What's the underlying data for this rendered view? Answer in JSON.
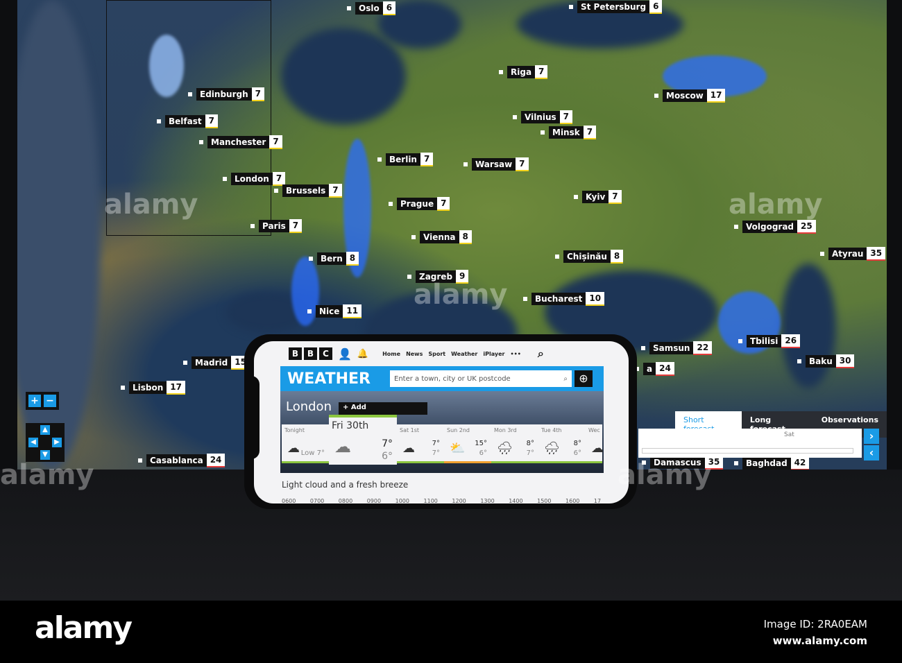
{
  "map": {
    "cities": [
      {
        "name": "Oslo",
        "temp": "6"
      },
      {
        "name": "St Petersburg",
        "temp": "6"
      },
      {
        "name": "Edinburgh",
        "temp": "7"
      },
      {
        "name": "Riga",
        "temp": "7"
      },
      {
        "name": "Moscow",
        "temp": "17"
      },
      {
        "name": "Belfast",
        "temp": "7"
      },
      {
        "name": "Vilnius",
        "temp": "7"
      },
      {
        "name": "Minsk",
        "temp": "7"
      },
      {
        "name": "Manchester",
        "temp": "7"
      },
      {
        "name": "Berlin",
        "temp": "7"
      },
      {
        "name": "Warsaw",
        "temp": "7"
      },
      {
        "name": "London",
        "temp": "7"
      },
      {
        "name": "Brussels",
        "temp": "7"
      },
      {
        "name": "Prague",
        "temp": "7"
      },
      {
        "name": "Kyiv",
        "temp": "7"
      },
      {
        "name": "Volgograd",
        "temp": "25"
      },
      {
        "name": "Paris",
        "temp": "7"
      },
      {
        "name": "Vienna",
        "temp": "8"
      },
      {
        "name": "Atyrau",
        "temp": "35"
      },
      {
        "name": "Chișinău",
        "temp": "8"
      },
      {
        "name": "Bern",
        "temp": "8"
      },
      {
        "name": "Zagreb",
        "temp": "9"
      },
      {
        "name": "Bucharest",
        "temp": "10"
      },
      {
        "name": "Nice",
        "temp": "11"
      },
      {
        "name": "Tbilisi",
        "temp": "26"
      },
      {
        "name": "Samsun",
        "temp": "22"
      },
      {
        "name": "Baku",
        "temp": "30"
      },
      {
        "name": "Madrid",
        "temp": "15"
      },
      {
        "name": "Lisbon",
        "temp": "17"
      },
      {
        "name": "Casablanca",
        "temp": "24"
      },
      {
        "name": "Damascus",
        "temp": "35"
      },
      {
        "name": "Baghdad",
        "temp": "42"
      },
      {
        "name": "a",
        "temp": "24"
      }
    ],
    "zoom_in": "+",
    "zoom_out": "−",
    "tabs": [
      "Short forecast",
      "Long forecast",
      "Observations"
    ],
    "timeline_label": "Sat",
    "next": "›",
    "prev": "‹"
  },
  "phone": {
    "bbc": [
      "B",
      "B",
      "C"
    ],
    "nav": [
      "Home",
      "News",
      "Sport",
      "Weather",
      "iPlayer",
      "•••"
    ],
    "weather_title": "WEATHER",
    "search_placeholder": "Enter a town, city or UK postcode",
    "location": "London",
    "add_label": "+ Add",
    "days": [
      {
        "label": "Tonight",
        "icon": "cloud",
        "high": "",
        "low": "Low 7°"
      },
      {
        "label": "Fri 30th",
        "icon": "cloud",
        "high": "7°",
        "low": "6°"
      },
      {
        "label": "Sat 1st",
        "icon": "cloud",
        "high": "7°",
        "low": "7°"
      },
      {
        "label": "Sun 2nd",
        "icon": "sun-cloud",
        "high": "15°",
        "low": "6°"
      },
      {
        "label": "Mon 3rd",
        "icon": "rain-cloud",
        "high": "8°",
        "low": "7°"
      },
      {
        "label": "Tue 4th",
        "icon": "rain-cloud",
        "high": "8°",
        "low": "6°"
      },
      {
        "label": "Wec",
        "icon": "cloud",
        "high": "",
        "low": ""
      }
    ],
    "description": "Light cloud and a fresh breeze",
    "hours": "0600 0700 0800 0900 1000 1100 1200 1300 1400 1500 1600 17"
  },
  "watermark": {
    "logo": "alamy",
    "image_id": "Image ID: 2RA0EAM",
    "url": "www.alamy.com",
    "overlay": "alamy"
  },
  "colors": {
    "accent": "#1a9be6",
    "good": "#8cc63f",
    "warm": "#f0a030"
  }
}
